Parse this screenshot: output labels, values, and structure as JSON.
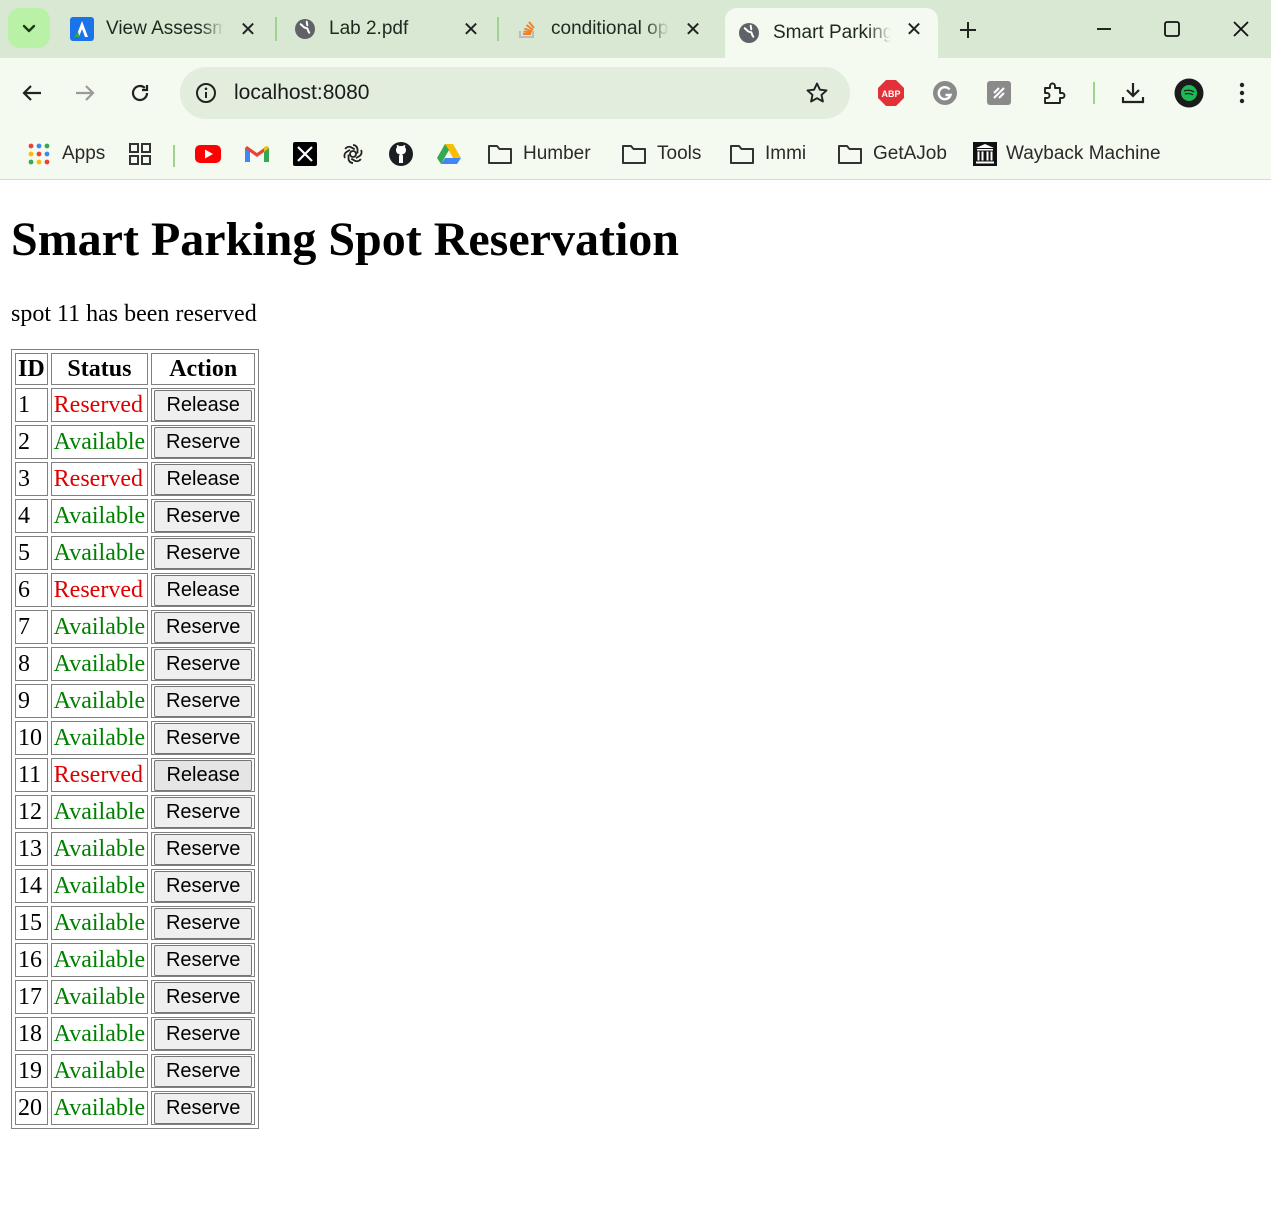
{
  "browser": {
    "tabs": [
      {
        "title": "View Assessment",
        "icon": "assessment-a-icon"
      },
      {
        "title": "Lab 2.pdf",
        "icon": "globe-icon"
      },
      {
        "title": "conditional operator",
        "icon": "stackoverflow-icon"
      },
      {
        "title": "Smart Parking Spot Reservation",
        "icon": "globe-icon",
        "active": true
      }
    ],
    "url": "localhost:8080",
    "bookmarks": {
      "apps": "Apps",
      "folders": [
        "Humber",
        "Tools",
        "Immi",
        "GetAJob"
      ],
      "wayback": "Wayback Machine"
    }
  },
  "page": {
    "title": "Smart Parking Spot Reservation",
    "message": "spot 11 has been reserved",
    "table": {
      "headers": [
        "ID",
        "Status",
        "Action"
      ],
      "rows": [
        {
          "id": "1",
          "status": "Reserved",
          "action": "Release"
        },
        {
          "id": "2",
          "status": "Available",
          "action": "Reserve"
        },
        {
          "id": "3",
          "status": "Reserved",
          "action": "Release"
        },
        {
          "id": "4",
          "status": "Available",
          "action": "Reserve"
        },
        {
          "id": "5",
          "status": "Available",
          "action": "Reserve"
        },
        {
          "id": "6",
          "status": "Reserved",
          "action": "Release"
        },
        {
          "id": "7",
          "status": "Available",
          "action": "Reserve"
        },
        {
          "id": "8",
          "status": "Available",
          "action": "Reserve"
        },
        {
          "id": "9",
          "status": "Available",
          "action": "Reserve"
        },
        {
          "id": "10",
          "status": "Available",
          "action": "Reserve"
        },
        {
          "id": "11",
          "status": "Reserved",
          "action": "Release"
        },
        {
          "id": "12",
          "status": "Available",
          "action": "Reserve"
        },
        {
          "id": "13",
          "status": "Available",
          "action": "Reserve"
        },
        {
          "id": "14",
          "status": "Available",
          "action": "Reserve"
        },
        {
          "id": "15",
          "status": "Available",
          "action": "Reserve"
        },
        {
          "id": "16",
          "status": "Available",
          "action": "Reserve"
        },
        {
          "id": "17",
          "status": "Available",
          "action": "Reserve"
        },
        {
          "id": "18",
          "status": "Available",
          "action": "Reserve"
        },
        {
          "id": "19",
          "status": "Available",
          "action": "Reserve"
        },
        {
          "id": "20",
          "status": "Available",
          "action": "Reserve"
        }
      ]
    }
  },
  "colors": {
    "reserved": "#e00000",
    "available": "#008000",
    "chrome_tabstrip": "#d9e8d3",
    "chrome_toolbar": "#f4faef"
  }
}
